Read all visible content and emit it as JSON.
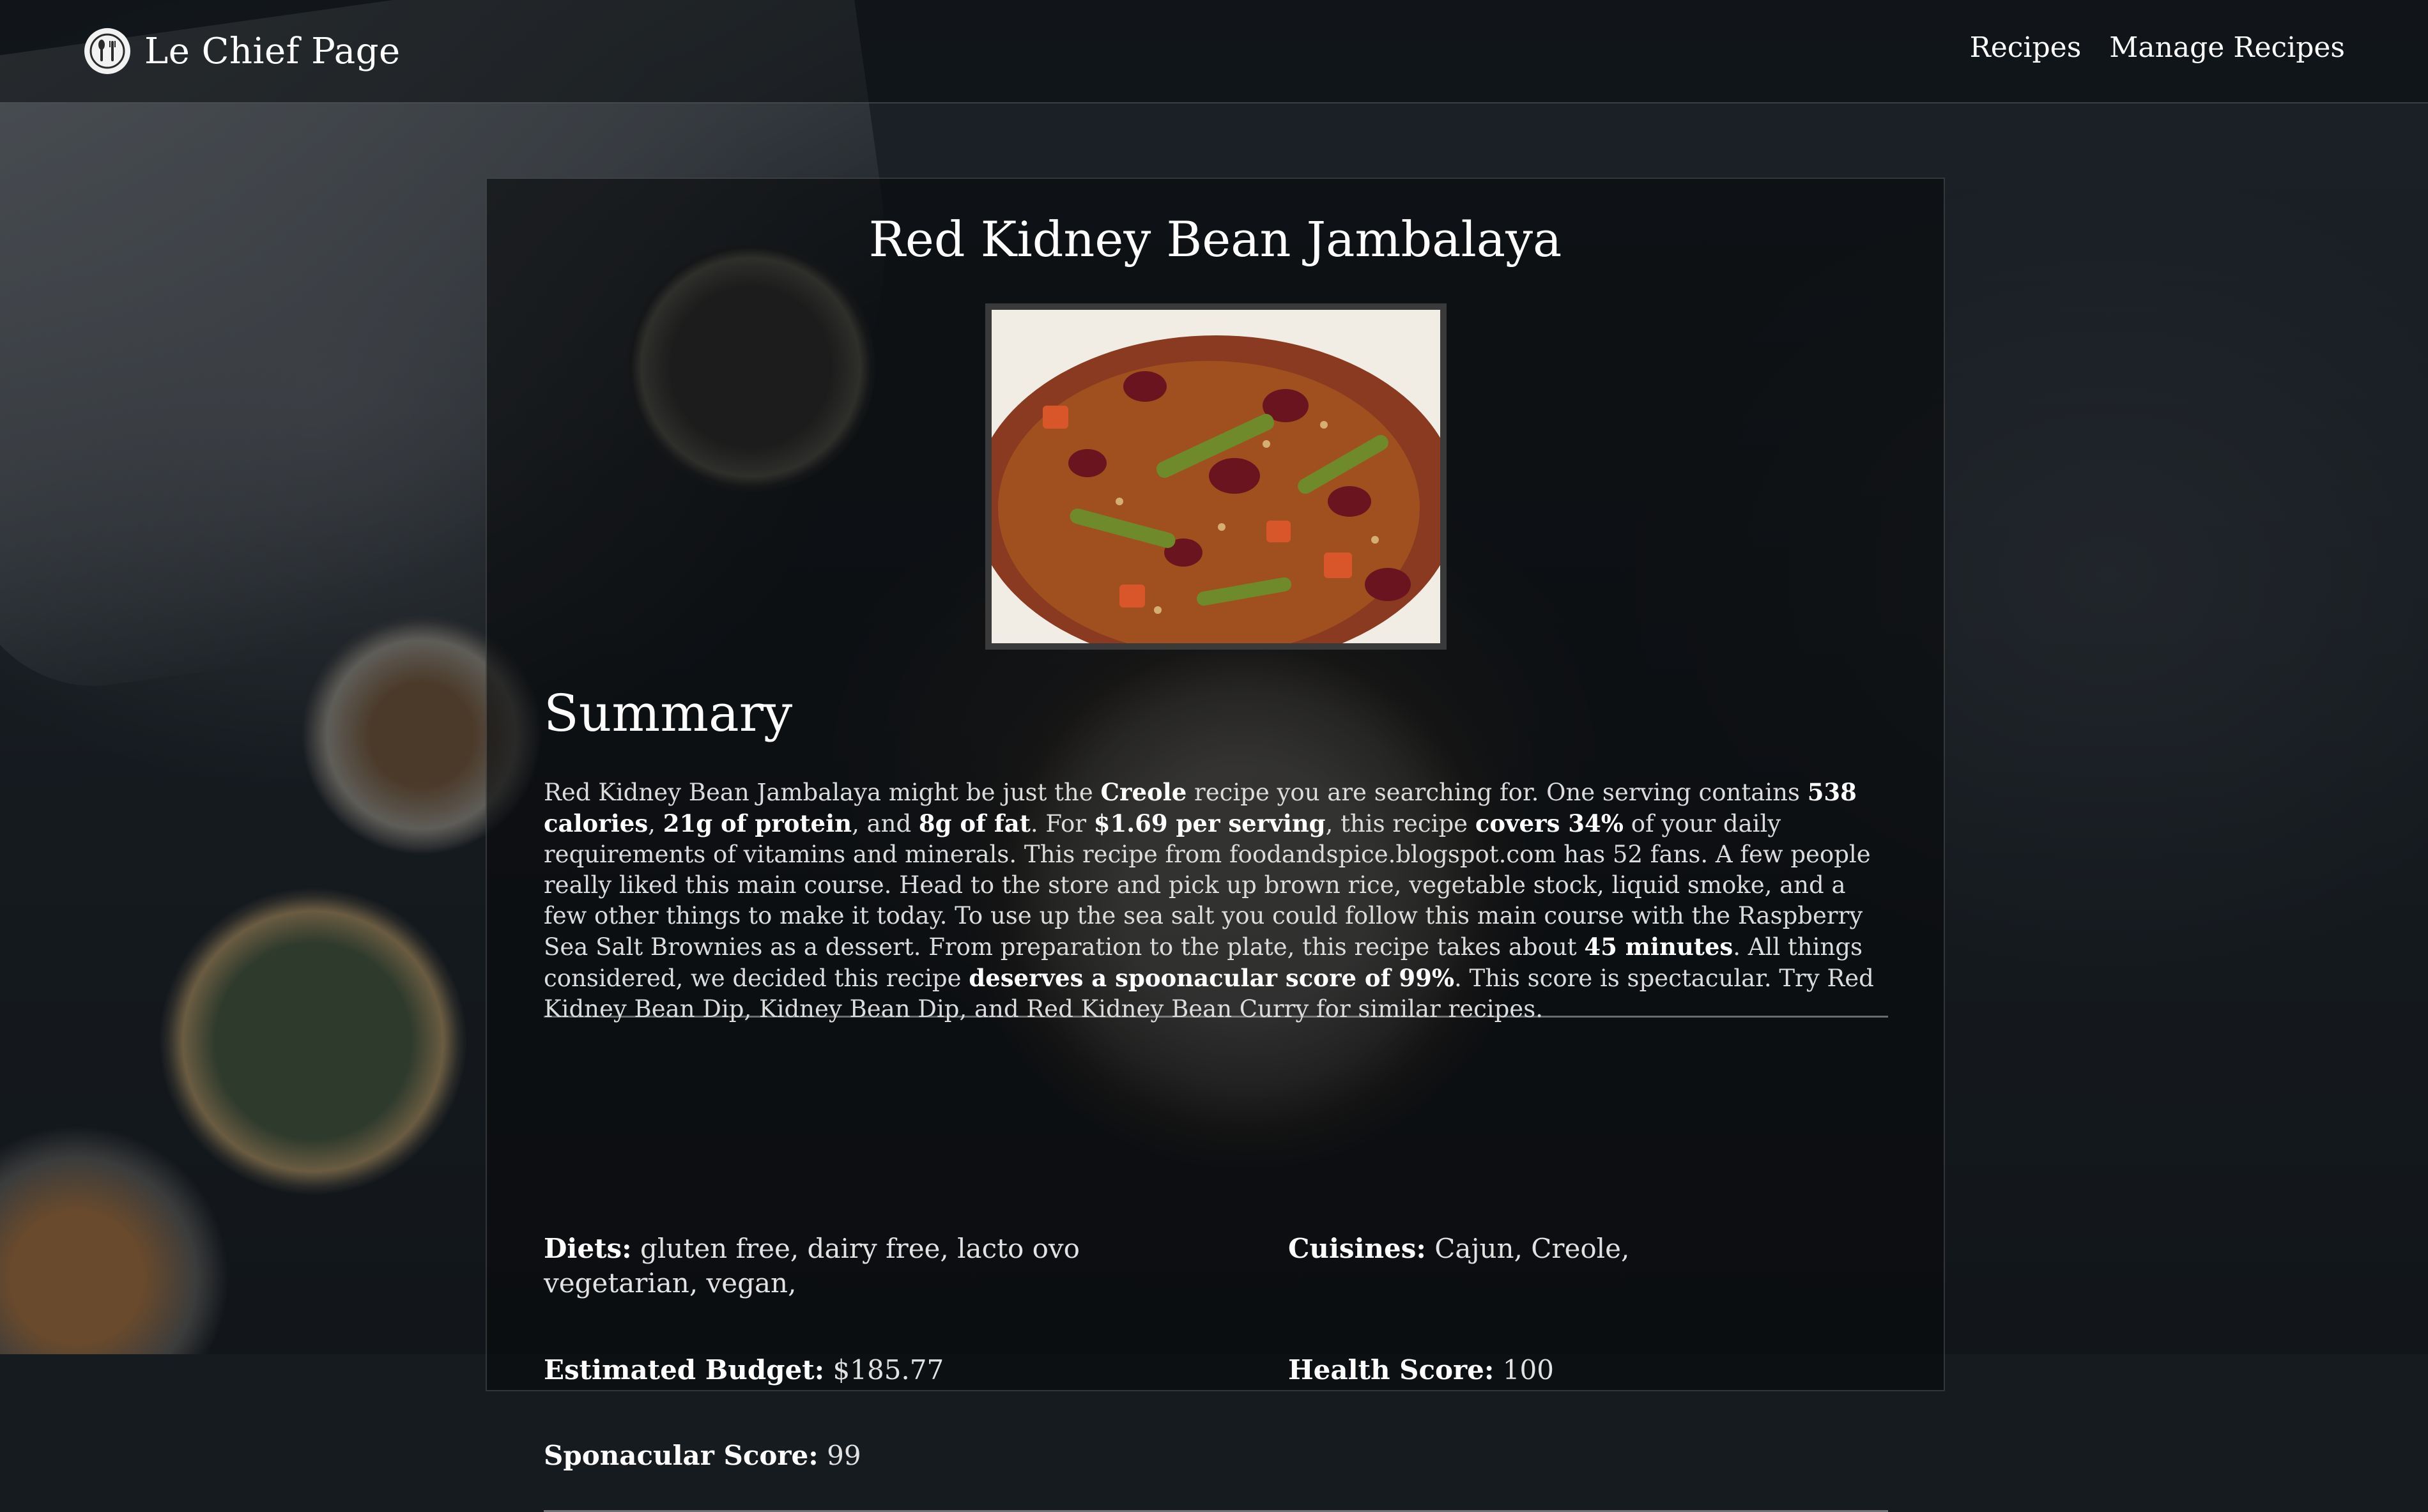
{
  "navbar": {
    "brand_title": "Le Chief Page",
    "links": [
      "Recipes",
      "Manage Recipes"
    ]
  },
  "recipe": {
    "title": "Red Kidney Bean Jambalaya",
    "image_alt": "Red Kidney Bean Jambalaya"
  },
  "summary": {
    "heading": "Summary",
    "segments": [
      {
        "t": "Red Kidney Bean Jambalaya might be just the ",
        "b": false
      },
      {
        "t": "Creole",
        "b": true
      },
      {
        "t": " recipe you are searching for. One serving contains ",
        "b": false
      },
      {
        "t": "538 calories",
        "b": true
      },
      {
        "t": ", ",
        "b": false
      },
      {
        "t": "21g of protein",
        "b": true
      },
      {
        "t": ", and ",
        "b": false
      },
      {
        "t": "8g of fat",
        "b": true
      },
      {
        "t": ". For ",
        "b": false
      },
      {
        "t": "$1.69 per serving",
        "b": true
      },
      {
        "t": ", this recipe ",
        "b": false
      },
      {
        "t": "covers 34%",
        "b": true
      },
      {
        "t": " of your daily requirements of vitamins and minerals. This recipe from foodandspice.blogspot.com has 52 fans. A few people really liked this main course. Head to the store and pick up brown rice, vegetable stock, liquid smoke, and a few other things to make it today. To use up the sea salt you could follow this main course with the Raspberry Sea Salt Brownies as a dessert. From preparation to the plate, this recipe takes about ",
        "b": false
      },
      {
        "t": "45 minutes",
        "b": true
      },
      {
        "t": ". All things considered, we decided this recipe ",
        "b": false
      },
      {
        "t": "deserves a spoonacular score of 99%",
        "b": true
      },
      {
        "t": ". This score is spectacular. Try Red Kidney Bean Dip, Kidney Bean Dip, and Red Kidney Bean Curry for similar recipes.",
        "b": false
      }
    ]
  },
  "details": {
    "diets_label": "Diets:",
    "diets_value": "gluten free, dairy free, lacto ovo vegetarian, vegan,",
    "cuisines_label": "Cuisines:",
    "cuisines_value": "Cajun, Creole,",
    "budget_label": "Estimated Budget:",
    "budget_value": "$185.77",
    "health_label": "Health Score:",
    "health_value": "100",
    "spoon_label": "Sponacular Score:",
    "spoon_value": "99"
  }
}
